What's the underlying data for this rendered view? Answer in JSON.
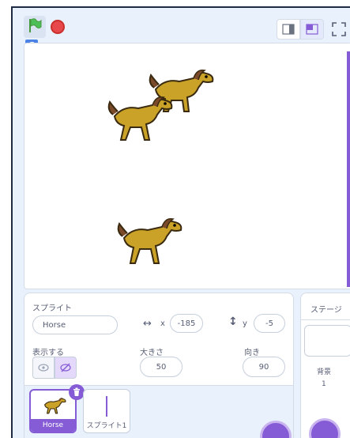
{
  "colors": {
    "accent": "#855cd6",
    "flag": "#4cbf56",
    "stop": "#e6484b",
    "panel_bg": "#e9f1fc"
  },
  "header": {
    "green_flag_icon": "green-flag-icon",
    "stop_icon": "stop-icon",
    "layout_small_icon": "small-stage-icon",
    "layout_normal_icon": "normal-stage-icon",
    "fullscreen_icon": "fullscreen-icon"
  },
  "sprite_info": {
    "sprite_label": "スプライト",
    "sprite_name": "Horse",
    "x_label": "x",
    "x_value": "-185",
    "y_label": "y",
    "y_value": "-5",
    "show_label": "表示する",
    "size_label": "大きさ",
    "size_value": "50",
    "direction_label": "向き",
    "direction_value": "90"
  },
  "stage_panel": {
    "title": "ステージ",
    "backdrop_label": "背景",
    "backdrop_count": "1"
  },
  "sprites": [
    {
      "name": "Horse",
      "selected": true
    },
    {
      "name": "スプライト1",
      "selected": false
    }
  ]
}
